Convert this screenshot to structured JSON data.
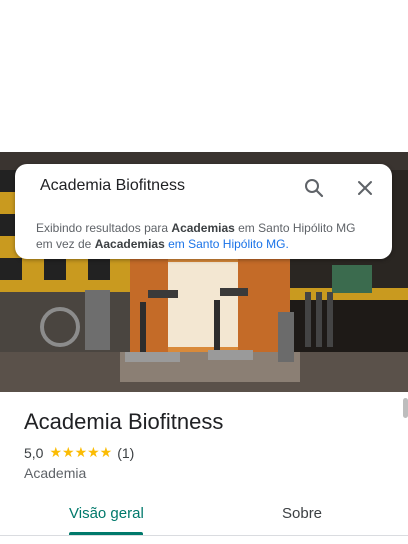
{
  "search": {
    "query": "Academia Biofitness",
    "search_icon": "search-icon",
    "close_icon": "close-icon"
  },
  "notice": {
    "prefix": "Exibindo resultados para ",
    "term": "Academias",
    "middle": " em Santo Hipólito MG",
    "instead_prefix": "em vez de ",
    "original_term": "Aacademias",
    "original_suffix": " em Santo Hipólito MG."
  },
  "place": {
    "name": "Academia Biofitness",
    "rating": "5,0",
    "stars": "★★★★★",
    "stars_value": 5,
    "reviews": "(1)",
    "category": "Academia"
  },
  "tabs": [
    {
      "label": "Visão geral",
      "active": true
    },
    {
      "label": "Sobre",
      "active": false
    }
  ],
  "colors": {
    "accent": "#00796b",
    "star": "#fbbc04",
    "link": "#1a73e8"
  }
}
